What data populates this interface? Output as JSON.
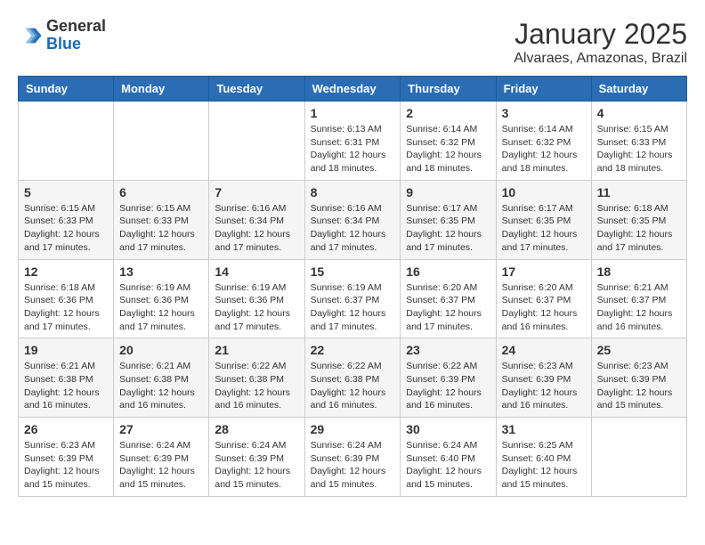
{
  "header": {
    "logo_general": "General",
    "logo_blue": "Blue",
    "month_title": "January 2025",
    "subtitle": "Alvaraes, Amazonas, Brazil"
  },
  "days_of_week": [
    "Sunday",
    "Monday",
    "Tuesday",
    "Wednesday",
    "Thursday",
    "Friday",
    "Saturday"
  ],
  "weeks": [
    [
      {
        "day": "",
        "info": ""
      },
      {
        "day": "",
        "info": ""
      },
      {
        "day": "",
        "info": ""
      },
      {
        "day": "1",
        "info": "Sunrise: 6:13 AM\nSunset: 6:31 PM\nDaylight: 12 hours\nand 18 minutes."
      },
      {
        "day": "2",
        "info": "Sunrise: 6:14 AM\nSunset: 6:32 PM\nDaylight: 12 hours\nand 18 minutes."
      },
      {
        "day": "3",
        "info": "Sunrise: 6:14 AM\nSunset: 6:32 PM\nDaylight: 12 hours\nand 18 minutes."
      },
      {
        "day": "4",
        "info": "Sunrise: 6:15 AM\nSunset: 6:33 PM\nDaylight: 12 hours\nand 18 minutes."
      }
    ],
    [
      {
        "day": "5",
        "info": "Sunrise: 6:15 AM\nSunset: 6:33 PM\nDaylight: 12 hours\nand 17 minutes."
      },
      {
        "day": "6",
        "info": "Sunrise: 6:15 AM\nSunset: 6:33 PM\nDaylight: 12 hours\nand 17 minutes."
      },
      {
        "day": "7",
        "info": "Sunrise: 6:16 AM\nSunset: 6:34 PM\nDaylight: 12 hours\nand 17 minutes."
      },
      {
        "day": "8",
        "info": "Sunrise: 6:16 AM\nSunset: 6:34 PM\nDaylight: 12 hours\nand 17 minutes."
      },
      {
        "day": "9",
        "info": "Sunrise: 6:17 AM\nSunset: 6:35 PM\nDaylight: 12 hours\nand 17 minutes."
      },
      {
        "day": "10",
        "info": "Sunrise: 6:17 AM\nSunset: 6:35 PM\nDaylight: 12 hours\nand 17 minutes."
      },
      {
        "day": "11",
        "info": "Sunrise: 6:18 AM\nSunset: 6:35 PM\nDaylight: 12 hours\nand 17 minutes."
      }
    ],
    [
      {
        "day": "12",
        "info": "Sunrise: 6:18 AM\nSunset: 6:36 PM\nDaylight: 12 hours\nand 17 minutes."
      },
      {
        "day": "13",
        "info": "Sunrise: 6:19 AM\nSunset: 6:36 PM\nDaylight: 12 hours\nand 17 minutes."
      },
      {
        "day": "14",
        "info": "Sunrise: 6:19 AM\nSunset: 6:36 PM\nDaylight: 12 hours\nand 17 minutes."
      },
      {
        "day": "15",
        "info": "Sunrise: 6:19 AM\nSunset: 6:37 PM\nDaylight: 12 hours\nand 17 minutes."
      },
      {
        "day": "16",
        "info": "Sunrise: 6:20 AM\nSunset: 6:37 PM\nDaylight: 12 hours\nand 17 minutes."
      },
      {
        "day": "17",
        "info": "Sunrise: 6:20 AM\nSunset: 6:37 PM\nDaylight: 12 hours\nand 16 minutes."
      },
      {
        "day": "18",
        "info": "Sunrise: 6:21 AM\nSunset: 6:37 PM\nDaylight: 12 hours\nand 16 minutes."
      }
    ],
    [
      {
        "day": "19",
        "info": "Sunrise: 6:21 AM\nSunset: 6:38 PM\nDaylight: 12 hours\nand 16 minutes."
      },
      {
        "day": "20",
        "info": "Sunrise: 6:21 AM\nSunset: 6:38 PM\nDaylight: 12 hours\nand 16 minutes."
      },
      {
        "day": "21",
        "info": "Sunrise: 6:22 AM\nSunset: 6:38 PM\nDaylight: 12 hours\nand 16 minutes."
      },
      {
        "day": "22",
        "info": "Sunrise: 6:22 AM\nSunset: 6:38 PM\nDaylight: 12 hours\nand 16 minutes."
      },
      {
        "day": "23",
        "info": "Sunrise: 6:22 AM\nSunset: 6:39 PM\nDaylight: 12 hours\nand 16 minutes."
      },
      {
        "day": "24",
        "info": "Sunrise: 6:23 AM\nSunset: 6:39 PM\nDaylight: 12 hours\nand 16 minutes."
      },
      {
        "day": "25",
        "info": "Sunrise: 6:23 AM\nSunset: 6:39 PM\nDaylight: 12 hours\nand 15 minutes."
      }
    ],
    [
      {
        "day": "26",
        "info": "Sunrise: 6:23 AM\nSunset: 6:39 PM\nDaylight: 12 hours\nand 15 minutes."
      },
      {
        "day": "27",
        "info": "Sunrise: 6:24 AM\nSunset: 6:39 PM\nDaylight: 12 hours\nand 15 minutes."
      },
      {
        "day": "28",
        "info": "Sunrise: 6:24 AM\nSunset: 6:39 PM\nDaylight: 12 hours\nand 15 minutes."
      },
      {
        "day": "29",
        "info": "Sunrise: 6:24 AM\nSunset: 6:39 PM\nDaylight: 12 hours\nand 15 minutes."
      },
      {
        "day": "30",
        "info": "Sunrise: 6:24 AM\nSunset: 6:40 PM\nDaylight: 12 hours\nand 15 minutes."
      },
      {
        "day": "31",
        "info": "Sunrise: 6:25 AM\nSunset: 6:40 PM\nDaylight: 12 hours\nand 15 minutes."
      },
      {
        "day": "",
        "info": ""
      }
    ]
  ]
}
